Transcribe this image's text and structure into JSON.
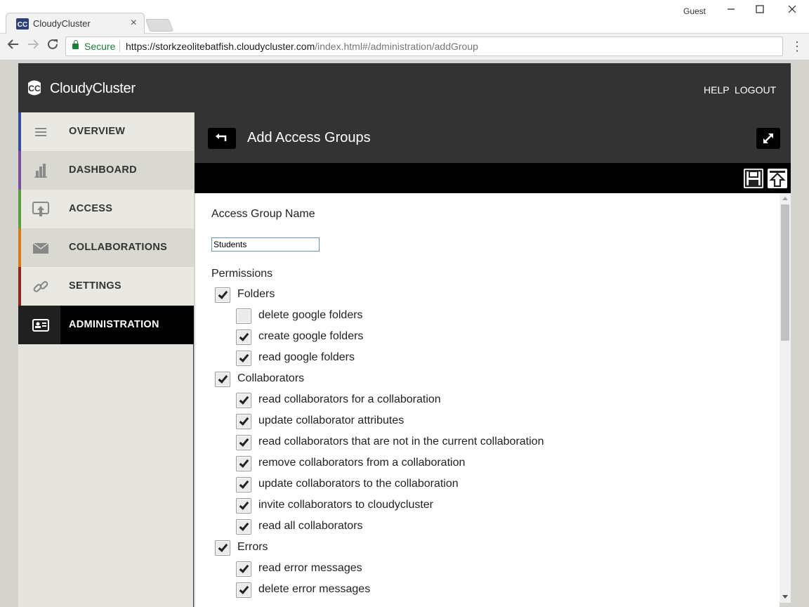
{
  "browser": {
    "tab_title": "CloudyCluster",
    "tab_close": "×",
    "profile": "Guest",
    "secure_label": "Secure",
    "url_host": "https://storkzeolitebatfish.cloudycluster.com",
    "url_path": "/index.html#/administration/addGroup"
  },
  "header": {
    "brand": "CloudyCluster",
    "help": "HELP",
    "logout": "LOGOUT"
  },
  "sidebar": {
    "items": [
      {
        "label": "OVERVIEW",
        "icon": "menu-icon",
        "accent": "#3a4a9c"
      },
      {
        "label": "DASHBOARD",
        "icon": "dashboard-icon",
        "accent": "#7a4fa0"
      },
      {
        "label": "ACCESS",
        "icon": "access-icon",
        "accent": "#5aa03c"
      },
      {
        "label": "COLLABORATIONS",
        "icon": "envelope-icon",
        "accent": "#d9781c"
      },
      {
        "label": "SETTINGS",
        "icon": "link-icon",
        "accent": "#8a2a1a"
      },
      {
        "label": "ADMINISTRATION",
        "icon": "id-card-icon",
        "accent": "#000000"
      }
    ]
  },
  "page": {
    "title": "Add Access Groups"
  },
  "form": {
    "group_name_label": "Access Group Name",
    "group_name_value": "Students",
    "permissions_label": "Permissions",
    "permissions": [
      {
        "label": "Folders",
        "checked": true,
        "level": 0
      },
      {
        "label": "delete google folders",
        "checked": false,
        "level": 1
      },
      {
        "label": "create google folders",
        "checked": true,
        "level": 1
      },
      {
        "label": "read google folders",
        "checked": true,
        "level": 1
      },
      {
        "label": "Collaborators",
        "checked": true,
        "level": 0
      },
      {
        "label": "read collaborators for a collaboration",
        "checked": true,
        "level": 1
      },
      {
        "label": "update collaborator attributes",
        "checked": true,
        "level": 1
      },
      {
        "label": "read collaborators that are not in the current collaboration",
        "checked": true,
        "level": 1
      },
      {
        "label": "remove collaborators from a collaboration",
        "checked": true,
        "level": 1
      },
      {
        "label": "update collaborators to the collaboration",
        "checked": true,
        "level": 1
      },
      {
        "label": "invite collaborators to cloudycluster",
        "checked": true,
        "level": 1
      },
      {
        "label": "read all collaborators",
        "checked": true,
        "level": 1
      },
      {
        "label": "Errors",
        "checked": true,
        "level": 0
      },
      {
        "label": "read error messages",
        "checked": true,
        "level": 1
      },
      {
        "label": "delete error messages",
        "checked": true,
        "level": 1
      }
    ]
  }
}
